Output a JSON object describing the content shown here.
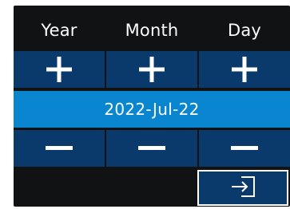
{
  "headers": {
    "year_label": "Year",
    "month_label": "Month",
    "day_label": "Day"
  },
  "date": {
    "display": "2022-Jul-22"
  },
  "icons": {
    "increment": "plus-icon",
    "decrement": "minus-icon",
    "confirm": "enter-icon"
  },
  "colors": {
    "background": "#111214",
    "button": "#0a3a6b",
    "date_bar": "#0a86d0",
    "text": "#ffffff"
  }
}
